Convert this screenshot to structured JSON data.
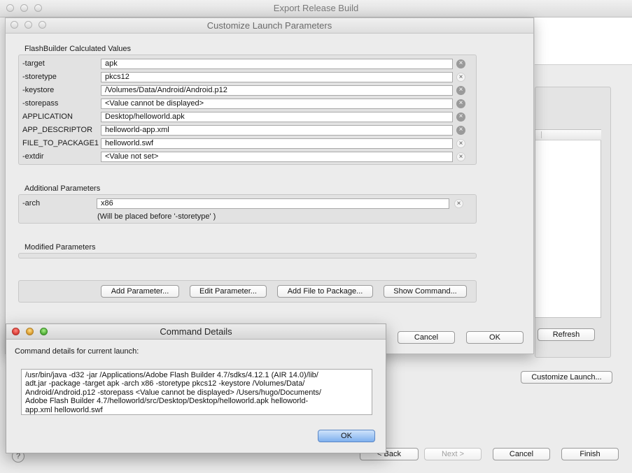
{
  "export_window": {
    "title": "Export Release Build",
    "refresh_label": "Refresh",
    "customize_launch_label": "Customize Launch...",
    "back_label": "< Back",
    "next_label": "Next >",
    "cancel_label": "Cancel",
    "finish_label": "Finish",
    "help_label": "?"
  },
  "customize_dialog": {
    "title": "Customize Launch Parameters",
    "calculated_section_title": "FlashBuilder Calculated Values",
    "calculated_params": [
      {
        "name": "-target",
        "value": "apk"
      },
      {
        "name": "-storetype",
        "value": "pkcs12"
      },
      {
        "name": "-keystore",
        "value": "/Volumes/Data/Android/Android.p12"
      },
      {
        "name": "-storepass",
        "value": "<Value cannot be displayed>"
      },
      {
        "name": "APPLICATION",
        "value": "Desktop/helloworld.apk"
      },
      {
        "name": "APP_DESCRIPTOR",
        "value": "helloworld-app.xml"
      },
      {
        "name": "FILE_TO_PACKAGE1",
        "value": "helloworld.swf"
      },
      {
        "name": "-extdir",
        "value": "<Value not set>"
      }
    ],
    "additional_section_title": "Additional Parameters",
    "additional_param": {
      "name": "-arch",
      "value": "x86",
      "note": "(Will be placed before  '-storetype' )"
    },
    "modified_section_title": "Modified Parameters",
    "buttons": {
      "add_parameter": "Add Parameter...",
      "edit_parameter": "Edit Parameter...",
      "add_file": "Add File to Package...",
      "show_command": "Show Command..."
    },
    "cancel_label": "Cancel",
    "ok_label": "OK"
  },
  "command_dialog": {
    "title": "Command Details",
    "intro": "Command details for current launch:",
    "command_lines": [
      "/usr/bin/java -d32 -jar /Applications/Adobe Flash Builder 4.7/sdks/4.12.1 (AIR 14.0)/lib/",
      "adt.jar -package -target apk -arch x86 -storetype pkcs12 -keystore /Volumes/Data/",
      "Android/Android.p12 -storepass <Value cannot be displayed> /Users/hugo/Documents/",
      "Adobe Flash Builder 4.7/helloworld/src/Desktop/Desktop/helloworld.apk helloworld-",
      "app.xml helloworld.swf"
    ],
    "ok_label": "OK"
  },
  "clear_icon_glyph": "×"
}
